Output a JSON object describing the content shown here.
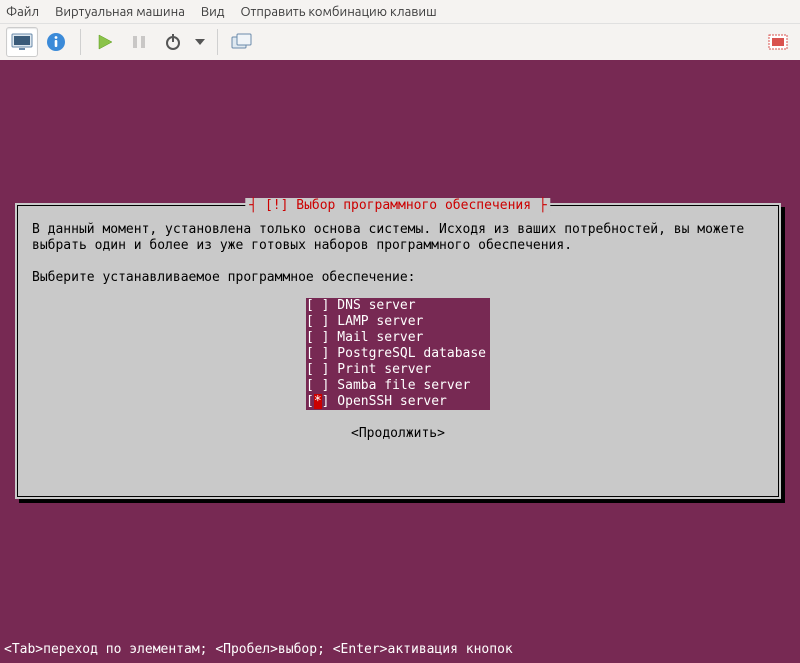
{
  "menubar": {
    "file": "Файл",
    "vm": "Виртуальная машина",
    "view": "Вид",
    "sendkeys": "Отправить комбинацию клавиш"
  },
  "installer": {
    "title": "[!] Выбор программного обеспечения",
    "description": "В данный момент, установлена только основа системы. Исходя из ваших потребностей, вы можете выбрать один и более из уже готовых наборов программного обеспечения.",
    "prompt": "Выберите устанавливаемое программное обеспечение:",
    "options": [
      {
        "checked": false,
        "selected": false,
        "label": "DNS server"
      },
      {
        "checked": false,
        "selected": false,
        "label": "LAMP server"
      },
      {
        "checked": false,
        "selected": false,
        "label": "Mail server"
      },
      {
        "checked": false,
        "selected": false,
        "label": "PostgreSQL database"
      },
      {
        "checked": false,
        "selected": false,
        "label": "Print server"
      },
      {
        "checked": false,
        "selected": false,
        "label": "Samba file server"
      },
      {
        "checked": true,
        "selected": true,
        "label": "OpenSSH server"
      }
    ],
    "continue": "<Продолжить>"
  },
  "footer": "<Tab>переход по элементам; <Пробел>выбор; <Enter>активация кнопок"
}
